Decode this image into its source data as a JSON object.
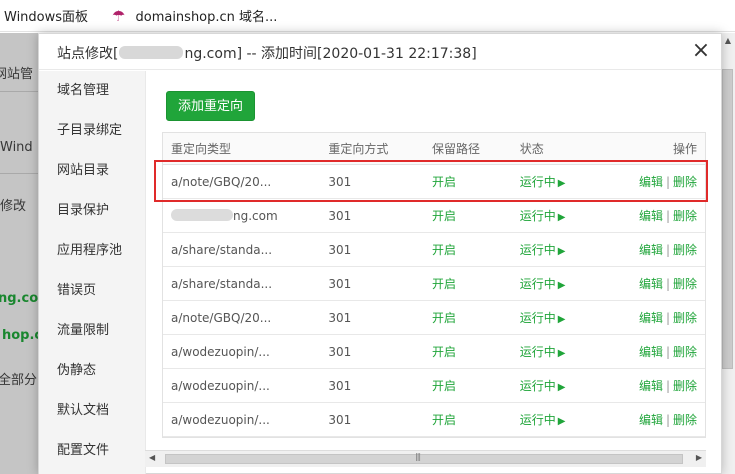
{
  "bookmarks": [
    {
      "label": "Windows面板"
    },
    {
      "label": "domainshop.cn 域名..."
    }
  ],
  "background_page": {
    "fragments": [
      "网站管",
      "Wind",
      "修改",
      "ng.com",
      "hop.cn",
      "全部分"
    ]
  },
  "modal": {
    "title_prefix": "站点修改[",
    "title_suffix": "ng.com] -- 添加时间[2020-01-31 22:17:38]",
    "close_label": "×"
  },
  "sidebar": {
    "items": [
      {
        "label": "域名管理"
      },
      {
        "label": "子目录绑定"
      },
      {
        "label": "网站目录"
      },
      {
        "label": "目录保护"
      },
      {
        "label": "应用程序池"
      },
      {
        "label": "错误页"
      },
      {
        "label": "流量限制"
      },
      {
        "label": "伪静态"
      },
      {
        "label": "默认文档"
      },
      {
        "label": "配置文件"
      }
    ]
  },
  "toolbar": {
    "add_redirect_label": "添加重定向"
  },
  "table": {
    "columns": [
      "重定向类型",
      "重定向方式",
      "保留路径",
      "状态",
      "操作"
    ],
    "rows": [
      {
        "type": "a/note/GBQ/20...",
        "method": "301",
        "keep_path": "开启",
        "status": "运行中",
        "edit": "编辑",
        "delete": "删除"
      },
      {
        "type": "ng.com",
        "method": "301",
        "keep_path": "开启",
        "status": "运行中",
        "edit": "编辑",
        "delete": "删除"
      },
      {
        "type": "a/share/standa...",
        "method": "301",
        "keep_path": "开启",
        "status": "运行中",
        "edit": "编辑",
        "delete": "删除"
      },
      {
        "type": "a/share/standa...",
        "method": "301",
        "keep_path": "开启",
        "status": "运行中",
        "edit": "编辑",
        "delete": "删除"
      },
      {
        "type": "a/note/GBQ/20...",
        "method": "301",
        "keep_path": "开启",
        "status": "运行中",
        "edit": "编辑",
        "delete": "删除"
      },
      {
        "type": "a/wodezuopin/...",
        "method": "301",
        "keep_path": "开启",
        "status": "运行中",
        "edit": "编辑",
        "delete": "删除"
      },
      {
        "type": "a/wodezuopin/...",
        "method": "301",
        "keep_path": "开启",
        "status": "运行中",
        "edit": "编辑",
        "delete": "删除"
      },
      {
        "type": "a/wodezuopin/...",
        "method": "301",
        "keep_path": "开启",
        "status": "运行中",
        "edit": "编辑",
        "delete": "删除"
      }
    ]
  },
  "colors": {
    "accent": "#20a53a",
    "highlight": "#e02a2a"
  },
  "icons": {
    "status": "play-icon",
    "close": "close-icon",
    "bookmark": "umbrella-icon"
  }
}
